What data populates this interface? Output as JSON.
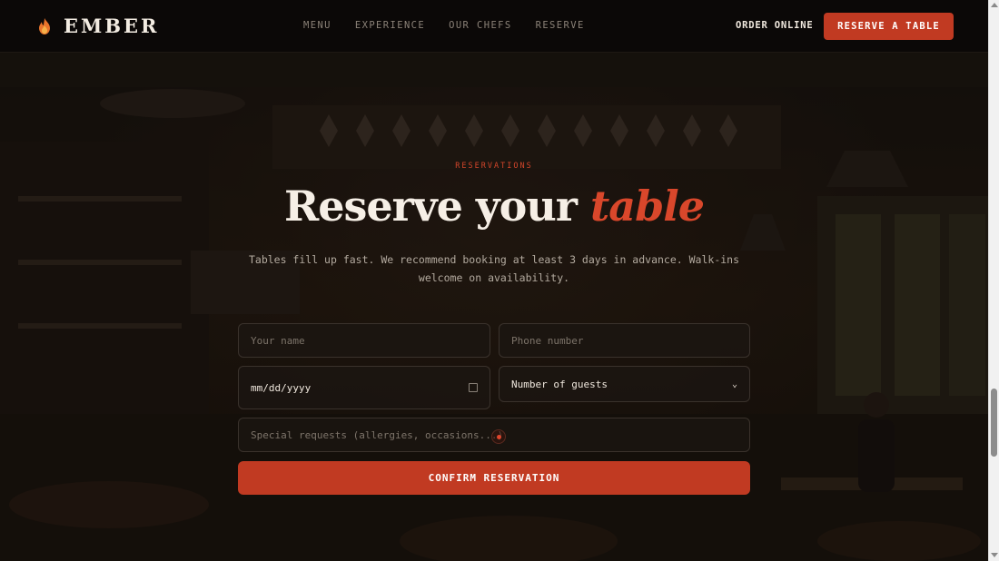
{
  "nav": {
    "brand": "EMBER",
    "links": [
      "MENU",
      "EXPERIENCE",
      "OUR CHEFS",
      "RESERVE"
    ],
    "order_online": "ORDER ONLINE",
    "reserve_table": "RESERVE A TABLE"
  },
  "hero": {
    "eyebrow": "RESERVATIONS",
    "headline_main": "Reserve your",
    "headline_accent": "table",
    "subtext": "Tables fill up fast. We recommend booking at least 3 days in advance. Walk-ins welcome on availability."
  },
  "form": {
    "name_placeholder": "Your name",
    "phone_placeholder": "Phone number",
    "date_value": "mm/dd/yyyy",
    "guests_value": "Number of guests",
    "requests_placeholder": "Special requests (allergies, occasions...)",
    "confirm_label": "CONFIRM RESERVATION"
  },
  "colors": {
    "accent": "#c13a22",
    "background": "#0b0807",
    "text": "#f6efe6"
  },
  "icons": {
    "brand": "flame-icon",
    "date": "calendar-icon",
    "guests": "chevron-down-icon",
    "requests": "record-dot-icon"
  }
}
